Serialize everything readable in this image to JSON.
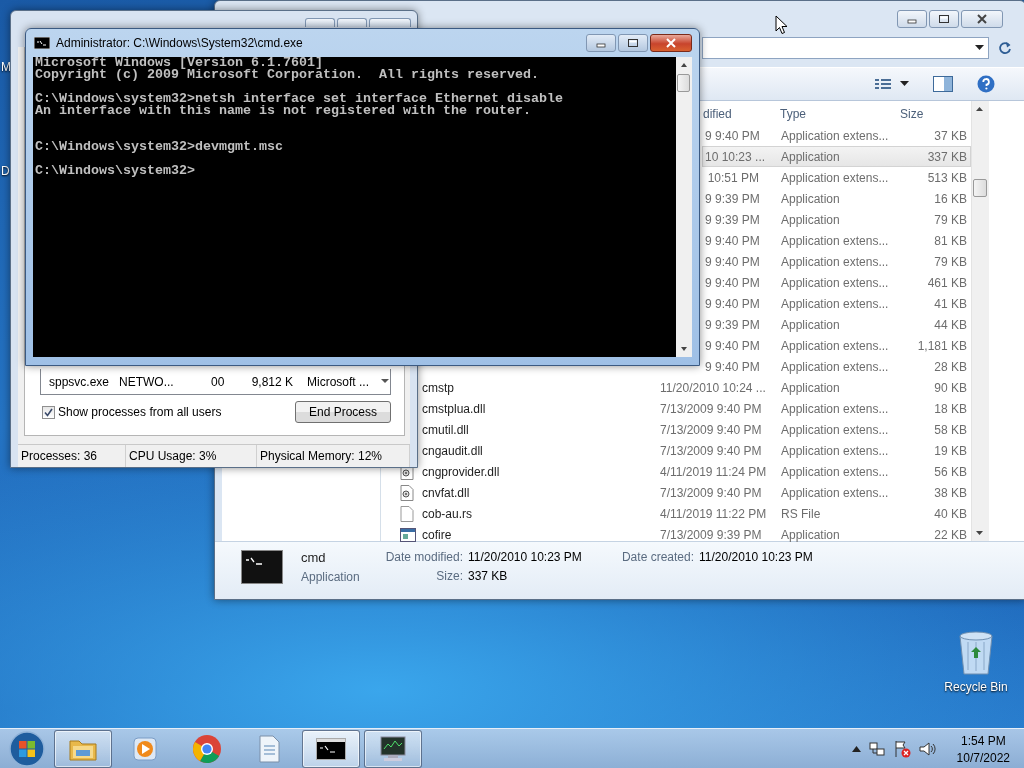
{
  "desktop": {
    "fragments": [
      {
        "text": "M"
      },
      {
        "text": "D"
      }
    ],
    "icons": [
      {
        "label": "Recycle Bin"
      }
    ]
  },
  "explorer": {
    "columns": [
      "dified",
      "Type",
      "Size"
    ],
    "files": [
      {
        "kind": "covered",
        "modified": "9 9:40 PM",
        "type": "Application extens...",
        "size": "37 KB",
        "selected": false
      },
      {
        "kind": "covered",
        "modified": "10 10:23 ...",
        "type": "Application",
        "size": "337 KB",
        "selected": true
      },
      {
        "kind": "covered",
        "modified": "10:51 PM",
        "type": "Application extens...",
        "size": "513 KB",
        "selected": false
      },
      {
        "kind": "covered",
        "modified": "9 9:39 PM",
        "type": "Application",
        "size": "16 KB",
        "selected": false
      },
      {
        "kind": "covered",
        "modified": "9 9:39 PM",
        "type": "Application",
        "size": "79 KB",
        "selected": false
      },
      {
        "kind": "covered",
        "modified": "9 9:40 PM",
        "type": "Application extens...",
        "size": "81 KB",
        "selected": false
      },
      {
        "kind": "covered",
        "modified": "9 9:40 PM",
        "type": "Application extens...",
        "size": "79 KB",
        "selected": false
      },
      {
        "kind": "covered",
        "modified": "9 9:40 PM",
        "type": "Application extens...",
        "size": "461 KB",
        "selected": false
      },
      {
        "kind": "covered",
        "modified": "9 9:40 PM",
        "type": "Application extens...",
        "size": "41 KB",
        "selected": false
      },
      {
        "kind": "covered",
        "modified": "9 9:39 PM",
        "type": "Application",
        "size": "44 KB",
        "selected": false
      },
      {
        "kind": "covered",
        "modified": "9 9:40 PM",
        "type": "Application extens...",
        "size": "1,181 KB",
        "selected": false
      },
      {
        "kind": "covered",
        "modified": "9 9:40 PM",
        "type": "Application extens...",
        "size": "28 KB",
        "selected": false
      },
      {
        "kind": "file",
        "name": "cmstp",
        "modified": "11/20/2010 10:24 ...",
        "type": "Application",
        "size": "90 KB",
        "selected": false
      },
      {
        "kind": "file",
        "name": "cmstplua.dll",
        "modified": "7/13/2009 9:40 PM",
        "type": "Application extens...",
        "size": "18 KB",
        "selected": false
      },
      {
        "kind": "file",
        "name": "cmutil.dll",
        "modified": "7/13/2009 9:40 PM",
        "type": "Application extens...",
        "size": "58 KB",
        "selected": false
      },
      {
        "kind": "file",
        "name": "cngaudit.dll",
        "modified": "7/13/2009 9:40 PM",
        "type": "Application extens...",
        "size": "19 KB",
        "selected": false
      },
      {
        "kind": "dll",
        "name": "cngprovider.dll",
        "modified": "4/11/2019 11:24 PM",
        "type": "Application extens...",
        "size": "56 KB",
        "selected": false
      },
      {
        "kind": "dll",
        "name": "cnvfat.dll",
        "modified": "7/13/2009 9:40 PM",
        "type": "Application extens...",
        "size": "38 KB",
        "selected": false
      },
      {
        "kind": "blank",
        "name": "cob-au.rs",
        "modified": "4/11/2019 11:22 PM",
        "type": "RS File",
        "size": "40 KB",
        "selected": false
      },
      {
        "kind": "app",
        "name": "cofire",
        "modified": "7/13/2009 9:39 PM",
        "type": "Application",
        "size": "22 KB",
        "selected": false
      }
    ],
    "details": {
      "name": "cmd",
      "type": "Application",
      "fields": [
        {
          "label": "Date modified:",
          "value": "11/20/2010 10:23 PM"
        },
        {
          "label": "Size:",
          "value": "337 KB"
        },
        {
          "label": "Date created:",
          "value": "11/20/2010 10:23 PM"
        }
      ]
    }
  },
  "task_manager": {
    "process_row": [
      "sppsvc.exe",
      "NETWO...",
      "00",
      "9,812 K",
      "Microsoft ..."
    ],
    "show_all_users": {
      "label": "Show processes from all users",
      "checked": true
    },
    "end_button": "End Process",
    "status_bar": [
      "Processes: 36",
      "CPU Usage: 3%",
      "Physical Memory: 12%"
    ]
  },
  "cmd": {
    "title": "Administrator: C:\\Windows\\System32\\cmd.exe",
    "lines": [
      {
        "kind": "text",
        "text": "Microsoft Windows [Version 6.1.7601]"
      },
      {
        "kind": "text",
        "text": "Copyright (c) 2009 Microsoft Corporation.  All rights reserved."
      },
      {
        "kind": "blank"
      },
      {
        "kind": "text",
        "text": "C:\\Windows\\system32>netsh interface set interface Ethernet disable"
      },
      {
        "kind": "text",
        "text": "An interface with this name is not registered with the router."
      },
      {
        "kind": "blank"
      },
      {
        "kind": "blank"
      },
      {
        "kind": "text",
        "text": "C:\\Windows\\system32>devmgmt.msc"
      },
      {
        "kind": "blank"
      },
      {
        "kind": "text",
        "text": "C:\\Windows\\system32>"
      }
    ]
  },
  "taskbar": {
    "buttons": [
      {
        "kind": "folder",
        "running": true,
        "active": false
      },
      {
        "kind": "media",
        "running": false,
        "active": false
      },
      {
        "kind": "browser",
        "running": false,
        "active": false
      },
      {
        "kind": "document",
        "running": false,
        "active": false
      },
      {
        "kind": "terminal",
        "running": true,
        "active": true
      },
      {
        "kind": "monitor",
        "running": true,
        "active": false
      }
    ],
    "clock": {
      "time": "1:54 PM",
      "date": "10/7/2022"
    }
  }
}
